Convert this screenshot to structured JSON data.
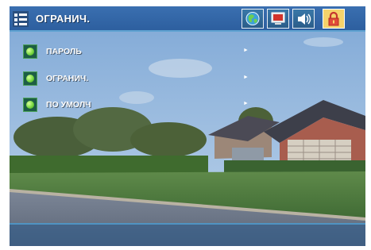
{
  "header": {
    "title": "ОГРАНИЧ."
  },
  "tabs": [
    {
      "name": "globe",
      "icon": "globe-icon"
    },
    {
      "name": "display",
      "icon": "monitor-icon"
    },
    {
      "name": "audio",
      "icon": "speaker-icon"
    },
    {
      "name": "lock",
      "icon": "padlock-icon",
      "active": true
    }
  ],
  "menu": {
    "items": [
      {
        "label": "ПАРОЛЬ"
      },
      {
        "label": "ОГРАНИЧ."
      },
      {
        "label": "ПО УМОЛЧ"
      }
    ],
    "arrow": "►"
  },
  "colors": {
    "bar": "#2d5f9f",
    "bar_border": "#5fa2d1",
    "active_tab": "#f6d36b",
    "bullet": "#6fd43a"
  }
}
